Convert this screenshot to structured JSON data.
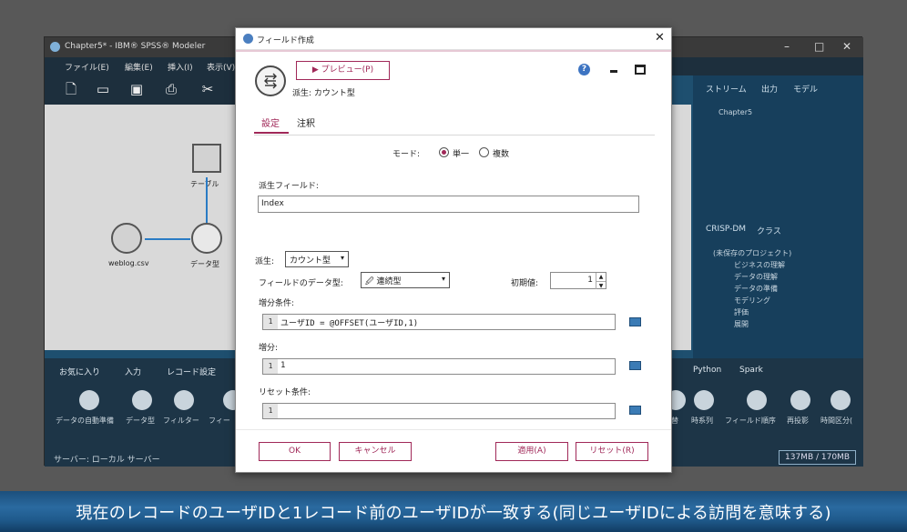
{
  "modeler": {
    "title": "Chapter5* - IBM® SPSS® Modeler",
    "menu": [
      "ファイル(E)",
      "編集(E)",
      "挿入(I)",
      "表示(V)"
    ],
    "canvas_nodes": {
      "source": "weblog.csv",
      "type": "データ型",
      "table": "テーブル"
    },
    "right_panel": {
      "tabs": [
        "ストリーム",
        "出力",
        "モデル"
      ],
      "stream_item": "Chapter5",
      "tabs2": [
        "CRISP-DM",
        "クラス"
      ],
      "tree": [
        "(未保存のプロジェクト)",
        "ビジネスの理解",
        "データの理解",
        "データの準備",
        "モデリング",
        "評価",
        "展開"
      ]
    },
    "palette_tabs": [
      "お気に入り",
      "入力",
      "レコード設定"
    ],
    "palette_tabs_right": [
      "Python",
      "Spark"
    ],
    "palette_left": [
      "データの自動準備",
      "データ型",
      "フィルター",
      "フィー"
    ],
    "palette_right": [
      "替",
      "時系列",
      "フィールド順序",
      "再投影",
      "時間区分("
    ],
    "status_server": "サーバー: ローカル サーバー",
    "status_memory": "137MB / 170MB"
  },
  "dialog": {
    "title": "フィールド作成",
    "preview_label": "プレビュー(P)",
    "subtitle": "派生: カウント型",
    "tabs": [
      "設定",
      "注釈"
    ],
    "mode_label": "モード:",
    "mode_options": [
      "単一",
      "複数"
    ],
    "derive_field_label": "派生フィールド:",
    "derive_field_value": "Index",
    "derive_label": "派生:",
    "derive_value": "カウント型",
    "field_type_label": "フィールドのデータ型:",
    "field_type_value": "連続型",
    "initial_label": "初期値:",
    "initial_value": "1",
    "increment_condition_label": "増分条件:",
    "increment_condition_expr": "ユーザID = @OFFSET(ユーザID,1)",
    "increment_label": "増分:",
    "increment_expr": "1",
    "reset_label": "リセット条件:",
    "reset_expr": "",
    "line_number": "1",
    "buttons": {
      "ok": "OK",
      "cancel": "キャンセル",
      "apply": "適用(A)",
      "reset": "リセット(R)"
    }
  },
  "caption": "現在のレコードのユーザIDと1レコード前のユーザIDが一致する(同じユーザIDによる訪問を意味する)"
}
